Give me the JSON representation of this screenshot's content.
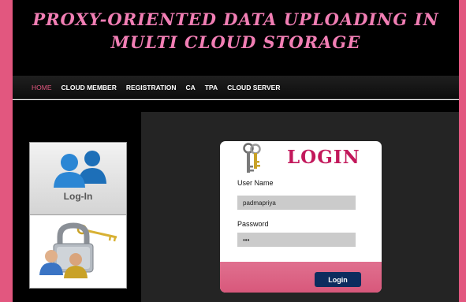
{
  "header": {
    "title_line1": "PROXY-ORIENTED DATA UPLOADING IN",
    "title_line2": "MULTI CLOUD STORAGE"
  },
  "nav": {
    "items": [
      {
        "label": "HOME",
        "active": true
      },
      {
        "label": "CLOUD MEMBER",
        "active": false
      },
      {
        "label": "REGISTRATION",
        "active": false
      },
      {
        "label": "CA",
        "active": false
      },
      {
        "label": "TPA",
        "active": false
      },
      {
        "label": "CLOUD SERVER",
        "active": false
      }
    ]
  },
  "sidebar": {
    "tile1_label": "Log-In",
    "tile1_icon": "users-icon",
    "tile2_icon": "user-lock-keys-icon"
  },
  "login": {
    "title": "LOGIN",
    "icon": "keys-icon",
    "username_label": "User Name",
    "username_value": "padmapriya",
    "password_label": "Password",
    "password_value": "•••",
    "submit_label": "Login"
  },
  "colors": {
    "accent_pink": "#e2577f",
    "title_pink": "#f17eb4",
    "login_title": "#c2185b",
    "button_navy": "#0d2c5e"
  }
}
